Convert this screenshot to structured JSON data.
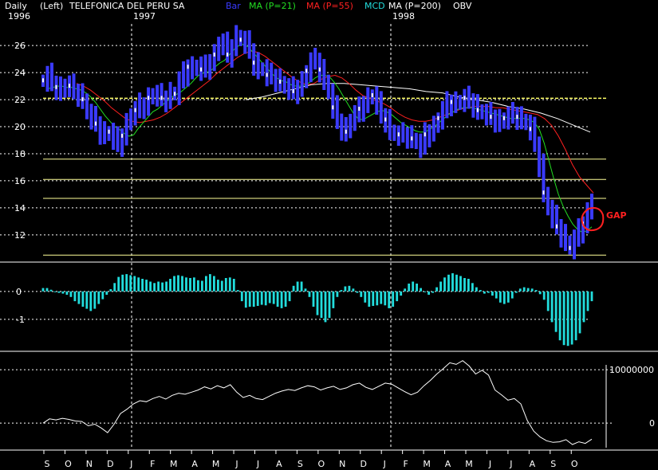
{
  "header": {
    "period": "Daily",
    "scale": "(Left)",
    "title": "TELEFONICA DEL PERU SA",
    "indicators": [
      {
        "label": "Bar",
        "color": "#3a3aff"
      },
      {
        "label": "MA (P=21)",
        "color": "#22dd22"
      },
      {
        "label": "MA (P=55)",
        "color": "#ff2020"
      },
      {
        "label": "MCD",
        "color": "#22dddd"
      },
      {
        "label": "MA (P=200)",
        "color": "#ffffff"
      },
      {
        "label": "OBV",
        "color": "#ffffff"
      }
    ],
    "years": [
      "1996",
      "1997",
      "1998"
    ]
  },
  "annotation": {
    "label": "GAP",
    "color": "#ff2020"
  },
  "colors": {
    "background": "#000000",
    "bar": "#3a3aff",
    "bar_white": "#ffffff",
    "ma21": "#22dd22",
    "ma55": "#ff2020",
    "ma200": "#ffffff",
    "macd": "#22dddd",
    "obv": "#ffffff",
    "hline": "#ffff66",
    "grid": "#ffffff"
  },
  "chart_data": [
    {
      "type": "line",
      "panel": "price",
      "months": [
        "S",
        "O",
        "N",
        "D",
        "J",
        "F",
        "M",
        "A",
        "M",
        "J",
        "J",
        "A",
        "S",
        "O",
        "N",
        "D",
        "J",
        "F",
        "M",
        "A",
        "M",
        "J",
        "J",
        "A",
        "S",
        "O"
      ],
      "y_ticks": [
        12,
        14,
        16,
        18,
        20,
        22,
        24,
        26
      ],
      "ylim": [
        10.4,
        27.6
      ],
      "horizontal_lines": [
        22.1,
        17.6,
        16.1,
        14.7,
        10.5
      ],
      "series": [
        {
          "name": "Bar",
          "values": [
            23.4,
            23.8,
            23.2,
            22.9,
            22.6,
            23.1,
            23.0,
            22.6,
            22.4,
            22.0,
            21.0,
            20.6,
            20.2,
            19.6,
            19.4,
            19.6,
            19.1,
            18.7,
            19.3,
            20.2,
            20.9,
            21.2,
            21.6,
            21.5,
            22.1,
            22.4,
            22.3,
            22.1,
            22.0,
            22.5,
            22.4,
            23.4,
            23.9,
            24.4,
            24.2,
            24.5,
            24.2,
            24.4,
            24.8,
            25.3,
            26.2,
            26.1,
            25.3,
            25.9,
            26.7,
            26.4,
            26.2,
            25.6,
            24.7,
            24.2,
            24.3,
            23.8,
            23.7,
            23.5,
            23.3,
            22.9,
            22.8,
            22.6,
            22.9,
            23.3,
            24.1,
            24.8,
            24.9,
            24.2,
            23.4,
            22.5,
            21.4,
            20.4,
            19.9,
            19.6,
            20.5,
            20.9,
            21.3,
            21.7,
            22.1,
            22.3,
            21.7,
            20.8,
            20.5,
            19.7,
            19.4,
            19.4,
            19.4,
            19.3,
            19.1,
            18.8,
            18.5,
            19.4,
            19.6,
            20.0,
            20.6,
            21.2,
            21.7,
            21.8,
            21.7,
            21.9,
            22.1,
            21.9,
            21.6,
            21.2,
            21.0,
            20.9,
            20.7,
            20.5,
            20.3,
            20.6,
            20.8,
            20.9,
            20.7,
            20.5,
            20.2,
            19.8,
            18.7,
            17.2,
            15.1,
            13.9,
            13.3,
            12.6,
            12.0,
            11.5,
            11.0,
            11.7,
            12.3,
            12.8,
            13.6,
            14.6
          ]
        },
        {
          "name": "MA (P=21)",
          "values": [
            22.8,
            22.9,
            23.0,
            23.0,
            22.9,
            22.9,
            22.8,
            22.7,
            22.5,
            22.2,
            21.8,
            21.3,
            20.8,
            20.4,
            20.0,
            19.8,
            19.5,
            19.3,
            19.4,
            19.9,
            20.3,
            20.7,
            21.1,
            21.3,
            21.6,
            21.9,
            22.2,
            22.4,
            22.6,
            22.9,
            23.2,
            23.6,
            23.9,
            24.0,
            24.1,
            24.4,
            24.7,
            24.9,
            25.3,
            25.7,
            26.0,
            26.1,
            25.9,
            25.5,
            25.1,
            24.7,
            24.3,
            23.9,
            23.6,
            23.4,
            23.3,
            23.1,
            23.0,
            23.0,
            23.1,
            23.3,
            23.6,
            23.8,
            23.8,
            23.7,
            23.3,
            22.8,
            22.2,
            21.6,
            21.0,
            20.6,
            20.5,
            20.7,
            20.9,
            21.1,
            21.2,
            21.1,
            20.9,
            20.6,
            20.3,
            20.1,
            19.9,
            19.7,
            19.6,
            19.6,
            19.8,
            20.0,
            20.3,
            20.6,
            20.9,
            21.1,
            21.3,
            21.4,
            21.4,
            21.4,
            21.3,
            21.2,
            21.1,
            21.0,
            20.9,
            20.8,
            20.7,
            20.6,
            20.6,
            20.6,
            20.6,
            20.5,
            20.3,
            19.8,
            18.8,
            17.5,
            16.2,
            15.0,
            14.1,
            13.4,
            12.8,
            12.4,
            12.2,
            12.3,
            12.6
          ]
        },
        {
          "name": "MA (P=55)",
          "values": [
            23.2,
            23.0,
            22.7,
            22.3,
            21.9,
            21.4,
            21.0,
            20.6,
            20.4,
            20.3,
            20.4,
            20.5,
            20.7,
            21.0,
            21.4,
            21.8,
            22.2,
            22.6,
            23.0,
            23.4,
            23.9,
            24.3,
            24.7,
            25.1,
            25.4,
            25.6,
            25.5,
            25.2,
            24.8,
            24.4,
            24.0,
            23.6,
            23.3,
            23.1,
            23.2,
            23.5,
            23.7,
            23.8,
            23.6,
            23.2,
            22.7,
            22.3,
            22.1,
            21.9,
            21.7,
            21.4,
            21.0,
            20.7,
            20.5,
            20.4,
            20.4,
            20.5,
            20.7,
            20.9,
            21.1,
            21.3,
            21.4,
            21.5,
            21.5,
            21.5,
            21.4,
            21.4,
            21.3,
            21.2,
            21.1,
            21.0,
            20.9,
            20.6,
            20.1,
            19.3,
            18.3,
            17.2,
            16.3,
            15.7,
            15.1
          ]
        },
        {
          "name": "MA (P=200)",
          "values": [
            22.0,
            22.2,
            22.5,
            22.8,
            23.1,
            23.2,
            23.2,
            23.1,
            23.0,
            22.9,
            22.8,
            22.6,
            22.5,
            22.2,
            22.0,
            21.8,
            21.5,
            21.3,
            21.0,
            20.6,
            20.1,
            19.6
          ]
        }
      ]
    },
    {
      "type": "bar",
      "panel": "MCD",
      "y_ticks": [
        0,
        -1
      ],
      "ylim": [
        -2.0,
        0.85
      ],
      "values": [
        0.12,
        0.12,
        0.06,
        0.0,
        -0.05,
        -0.08,
        -0.12,
        -0.2,
        -0.35,
        -0.45,
        -0.55,
        -0.62,
        -0.7,
        -0.62,
        -0.45,
        -0.28,
        -0.12,
        0.08,
        0.3,
        0.52,
        0.6,
        0.62,
        0.58,
        0.55,
        0.5,
        0.45,
        0.42,
        0.35,
        0.3,
        0.35,
        0.32,
        0.35,
        0.45,
        0.55,
        0.58,
        0.55,
        0.5,
        0.48,
        0.5,
        0.4,
        0.38,
        0.55,
        0.62,
        0.55,
        0.42,
        0.38,
        0.48,
        0.5,
        0.45,
        0.05,
        -0.35,
        -0.58,
        -0.55,
        -0.55,
        -0.52,
        -0.48,
        -0.5,
        -0.42,
        -0.45,
        -0.55,
        -0.6,
        -0.55,
        -0.35,
        0.2,
        0.35,
        0.35,
        0.1,
        -0.2,
        -0.55,
        -0.85,
        -0.95,
        -1.1,
        -0.95,
        -0.6,
        -0.2,
        0.05,
        0.18,
        0.2,
        0.1,
        -0.05,
        -0.2,
        -0.4,
        -0.55,
        -0.52,
        -0.5,
        -0.45,
        -0.5,
        -0.6,
        -0.55,
        -0.35,
        -0.15,
        0.1,
        0.28,
        0.35,
        0.28,
        0.12,
        0.0,
        -0.12,
        -0.05,
        0.15,
        0.35,
        0.5,
        0.6,
        0.65,
        0.6,
        0.55,
        0.48,
        0.45,
        0.3,
        0.15,
        0.05,
        -0.08,
        -0.05,
        -0.15,
        -0.25,
        -0.4,
        -0.45,
        -0.4,
        -0.25,
        -0.05,
        0.1,
        0.15,
        0.12,
        0.1,
        0.05,
        -0.1,
        -0.3,
        -0.7,
        -1.1,
        -1.45,
        -1.75,
        -1.92,
        -1.95,
        -1.9,
        -1.75,
        -1.5,
        -1.1,
        -0.7,
        -0.35
      ]
    },
    {
      "type": "line",
      "panel": "OBV",
      "y_ticks": [
        10000000,
        0
      ],
      "ylim": [
        -4600000,
        12400000
      ],
      "series": [
        {
          "name": "OBV",
          "values": [
            0,
            800000,
            600000,
            900000,
            700000,
            400000,
            300000,
            -500000,
            -200000,
            -900000,
            -1800000,
            -200000,
            1800000,
            2600000,
            3600000,
            4200000,
            4000000,
            4600000,
            5000000,
            4500000,
            5200000,
            5600000,
            5400000,
            5800000,
            6200000,
            6800000,
            6400000,
            7000000,
            6600000,
            7200000,
            5800000,
            4800000,
            5200000,
            4600000,
            4400000,
            5000000,
            5600000,
            6000000,
            6300000,
            6100000,
            6600000,
            7000000,
            6800000,
            6200000,
            6600000,
            6900000,
            6300000,
            6600000,
            7200000,
            7500000,
            6700000,
            6300000,
            6900000,
            7500000,
            7300000,
            6600000,
            5900000,
            5300000,
            5800000,
            7000000,
            8000000,
            9200000,
            10200000,
            11300000,
            11000000,
            11700000,
            10700000,
            9200000,
            9900000,
            9000000,
            6200000,
            5300000,
            4300000,
            4600000,
            3600000,
            500000,
            -1500000,
            -2600000,
            -3300000,
            -3600000,
            -3500000,
            -3100000,
            -4000000,
            -3500000,
            -3800000,
            -3000000
          ]
        }
      ]
    }
  ]
}
